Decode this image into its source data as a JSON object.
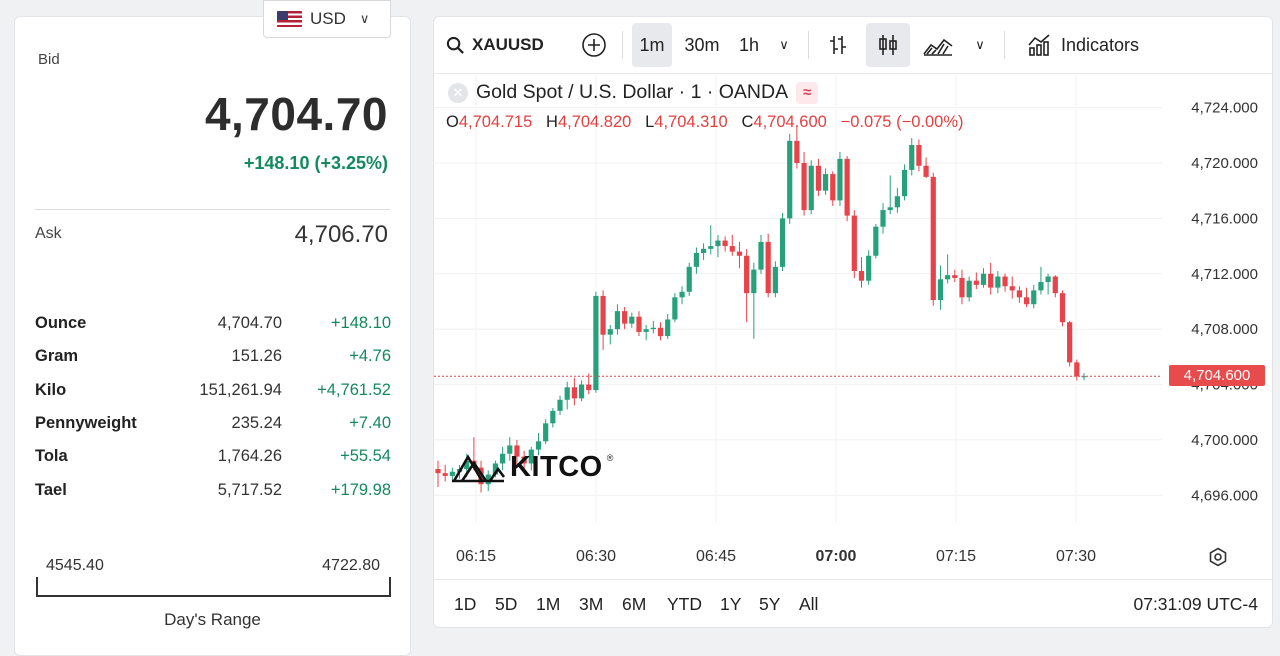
{
  "currency": {
    "code": "USD",
    "flag_icon": "us-flag-icon"
  },
  "quote": {
    "bid_label": "Bid",
    "bid": "4,704.70",
    "change": "+148.10 (+3.25%)",
    "ask_label": "Ask",
    "ask": "4,706.70",
    "units": [
      {
        "name": "Ounce",
        "price": "4,704.70",
        "change": "+148.10"
      },
      {
        "name": "Gram",
        "price": "151.26",
        "change": "+4.76"
      },
      {
        "name": "Kilo",
        "price": "151,261.94",
        "change": "+4,761.52"
      },
      {
        "name": "Pennyweight",
        "price": "235.24",
        "change": "+7.40"
      },
      {
        "name": "Tola",
        "price": "1,764.26",
        "change": "+55.54"
      },
      {
        "name": "Tael",
        "price": "5,717.52",
        "change": "+179.98"
      }
    ],
    "range_low": "4545.40",
    "range_high": "4722.80",
    "range_label": "Day's Range"
  },
  "toolbar": {
    "symbol": "XAUUSD",
    "intervals": [
      "1m",
      "30m",
      "1h"
    ],
    "active_interval": "1m",
    "indicators_label": "Indicators"
  },
  "legend": {
    "title": "Gold Spot / U.S. Dollar · 1 · OANDA",
    "o_key": "O",
    "o": "4,704.715",
    "h_key": "H",
    "h": "4,704.820",
    "l_key": "L",
    "l": "4,704.310",
    "c_key": "C",
    "c": "4,704.600",
    "change": "−0.075 (−0.00%)"
  },
  "last_price": "4,704.600",
  "logo": "KITCO",
  "ranges": [
    "1D",
    "5D",
    "1M",
    "3M",
    "6M",
    "YTD",
    "1Y",
    "5Y",
    "All"
  ],
  "clock": "07:31:09 UTC-4",
  "colors": {
    "up": "#26a17b",
    "down": "#e8424a",
    "accent": "#138a5d"
  },
  "chart_data": {
    "type": "candlestick",
    "x_ticks": [
      "06:15",
      "06:30",
      "06:45",
      "07:00",
      "07:15",
      "07:30"
    ],
    "y_ticks": [
      "4,724.000",
      "4,720.000",
      "4,716.000",
      "4,712.000",
      "4,708.000",
      "4,704.000",
      "4,700.000",
      "4,696.000"
    ],
    "ylim": [
      4694.0,
      4726.5
    ],
    "candles": [
      [
        4697.9,
        4698.5,
        4696.6,
        4697.6
      ],
      [
        4697.6,
        4698.2,
        4697.0,
        4697.4
      ],
      [
        4697.4,
        4698.0,
        4697.0,
        4697.7
      ],
      [
        4697.7,
        4698.2,
        4697.2,
        4697.9
      ],
      [
        4697.9,
        4699.0,
        4697.3,
        4698.5
      ],
      [
        4698.5,
        4700.2,
        4697.8,
        4698.0
      ],
      [
        4698.0,
        4698.5,
        4696.2,
        4696.8
      ],
      [
        4696.8,
        4697.8,
        4696.3,
        4697.5
      ],
      [
        4697.5,
        4698.5,
        4697.3,
        4698.3
      ],
      [
        4698.3,
        4699.5,
        4697.8,
        4699.0
      ],
      [
        4699.0,
        4700.2,
        4698.5,
        4699.6
      ],
      [
        4699.6,
        4700.0,
        4698.2,
        4698.8
      ],
      [
        4698.8,
        4699.2,
        4697.9,
        4698.3
      ],
      [
        4698.3,
        4699.5,
        4697.8,
        4699.3
      ],
      [
        4699.3,
        4700.5,
        4698.9,
        4699.9
      ],
      [
        4699.9,
        4701.5,
        4699.7,
        4701.2
      ],
      [
        4701.2,
        4702.3,
        4700.9,
        4702.1
      ],
      [
        4702.1,
        4703.2,
        4701.8,
        4702.9
      ],
      [
        4702.9,
        4704.2,
        4702.2,
        4703.8
      ],
      [
        4703.8,
        4704.5,
        4702.5,
        4703.0
      ],
      [
        4703.0,
        4704.3,
        4702.8,
        4704.0
      ],
      [
        4704.0,
        4704.8,
        4703.3,
        4703.6
      ],
      [
        4703.6,
        4710.7,
        4703.4,
        4710.4
      ],
      [
        4710.4,
        4710.8,
        4706.5,
        4707.6
      ],
      [
        4707.6,
        4708.3,
        4706.9,
        4708.0
      ],
      [
        4708.0,
        4709.8,
        4707.6,
        4709.3
      ],
      [
        4709.3,
        4709.6,
        4708.0,
        4708.4
      ],
      [
        4708.4,
        4709.2,
        4708.1,
        4708.9
      ],
      [
        4708.9,
        4709.3,
        4707.5,
        4707.8
      ],
      [
        4707.8,
        4708.3,
        4707.2,
        4708.0
      ],
      [
        4708.0,
        4708.6,
        4707.7,
        4708.1
      ],
      [
        4708.1,
        4708.5,
        4707.2,
        4707.5
      ],
      [
        4707.5,
        4709.1,
        4707.3,
        4708.7
      ],
      [
        4708.7,
        4710.6,
        4708.5,
        4710.3
      ],
      [
        4710.3,
        4711.1,
        4709.8,
        4710.7
      ],
      [
        4710.7,
        4712.8,
        4710.4,
        4712.5
      ],
      [
        4712.5,
        4713.9,
        4712.0,
        4713.5
      ],
      [
        4713.5,
        4714.2,
        4713.0,
        4713.8
      ],
      [
        4713.8,
        4715.5,
        4713.4,
        4714.0
      ],
      [
        4714.0,
        4714.8,
        4713.2,
        4714.4
      ],
      [
        4714.4,
        4714.7,
        4713.6,
        4714.0
      ],
      [
        4714.0,
        4714.8,
        4713.3,
        4713.6
      ],
      [
        4713.6,
        4714.3,
        4712.4,
        4713.3
      ],
      [
        4713.3,
        4713.8,
        4708.5,
        4710.6
      ],
      [
        4710.6,
        4712.8,
        4707.3,
        4712.3
      ],
      [
        4712.3,
        4714.8,
        4712.0,
        4714.3
      ],
      [
        4714.3,
        4714.9,
        4710.3,
        4710.6
      ],
      [
        4710.6,
        4712.9,
        4710.3,
        4712.5
      ],
      [
        4712.5,
        4716.4,
        4712.2,
        4716.0
      ],
      [
        4716.0,
        4722.1,
        4715.6,
        4721.6
      ],
      [
        4721.6,
        4722.6,
        4719.6,
        4720.0
      ],
      [
        4720.0,
        4720.8,
        4716.2,
        4716.6
      ],
      [
        4716.6,
        4720.2,
        4716.3,
        4719.8
      ],
      [
        4719.8,
        4720.3,
        4717.6,
        4718.0
      ],
      [
        4718.0,
        4719.6,
        4717.7,
        4719.2
      ],
      [
        4719.2,
        4719.4,
        4716.9,
        4717.3
      ],
      [
        4717.3,
        4720.8,
        4716.9,
        4720.3
      ],
      [
        4720.3,
        4720.5,
        4715.8,
        4716.2
      ],
      [
        4716.2,
        4716.6,
        4711.7,
        4712.2
      ],
      [
        4712.2,
        4713.2,
        4711.0,
        4711.5
      ],
      [
        4711.5,
        4713.7,
        4711.2,
        4713.3
      ],
      [
        4713.3,
        4715.6,
        4713.1,
        4715.4
      ],
      [
        4715.4,
        4717.1,
        4714.9,
        4716.6
      ],
      [
        4716.6,
        4719.1,
        4716.3,
        4716.8
      ],
      [
        4716.8,
        4718.2,
        4716.4,
        4717.6
      ],
      [
        4717.6,
        4719.9,
        4717.3,
        4719.5
      ],
      [
        4719.5,
        4721.8,
        4719.1,
        4721.3
      ],
      [
        4721.3,
        4721.7,
        4719.4,
        4719.8
      ],
      [
        4719.8,
        4720.4,
        4718.9,
        4719.0
      ],
      [
        4719.0,
        4719.3,
        4709.7,
        4710.1
      ],
      [
        4710.1,
        4712.6,
        4709.4,
        4711.6
      ],
      [
        4711.6,
        4713.4,
        4711.3,
        4711.9
      ],
      [
        4711.9,
        4712.3,
        4711.4,
        4711.7
      ],
      [
        4711.7,
        4712.3,
        4709.8,
        4710.3
      ],
      [
        4710.3,
        4711.8,
        4710.0,
        4711.5
      ],
      [
        4711.5,
        4712.1,
        4710.9,
        4711.2
      ],
      [
        4711.2,
        4712.4,
        4711.0,
        4712.0
      ],
      [
        4712.0,
        4712.8,
        4710.5,
        4711.0
      ],
      [
        4711.0,
        4712.2,
        4710.6,
        4711.8
      ],
      [
        4711.8,
        4712.0,
        4710.7,
        4711.1
      ],
      [
        4711.1,
        4711.8,
        4710.2,
        4710.8
      ],
      [
        4710.8,
        4711.1,
        4709.9,
        4710.3
      ],
      [
        4710.3,
        4711.0,
        4709.6,
        4709.8
      ],
      [
        4709.8,
        4711.2,
        4709.5,
        4710.8
      ],
      [
        4710.8,
        4712.5,
        4710.5,
        4711.4
      ],
      [
        4711.4,
        4712.0,
        4710.5,
        4711.8
      ],
      [
        4711.8,
        4711.9,
        4710.3,
        4710.6
      ],
      [
        4710.6,
        4710.8,
        4708.2,
        4708.5
      ],
      [
        4708.5,
        4708.6,
        4705.3,
        4705.6
      ],
      [
        4705.6,
        4705.8,
        4704.3,
        4704.6
      ],
      [
        4704.6,
        4704.82,
        4704.31,
        4704.6
      ]
    ]
  }
}
